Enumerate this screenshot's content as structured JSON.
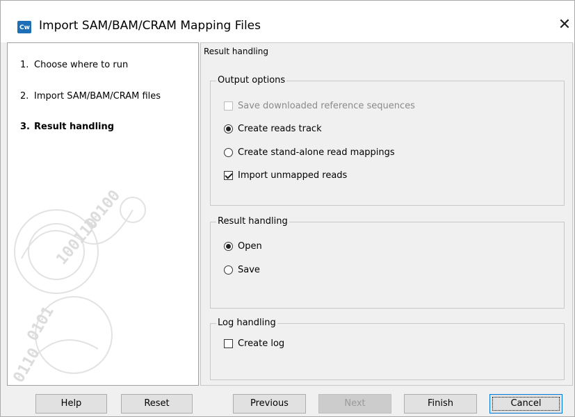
{
  "window": {
    "title": "Import SAM/BAM/CRAM Mapping Files",
    "app_icon_text": "Cw"
  },
  "steps": [
    {
      "number": "1.",
      "label": "Choose where to run",
      "active": false
    },
    {
      "number": "2.",
      "label": "Import SAM/BAM/CRAM files",
      "active": false
    },
    {
      "number": "3.",
      "label": "Result handling",
      "active": true
    }
  ],
  "main": {
    "heading": "Result handling",
    "output_options": {
      "legend": "Output options",
      "save_downloaded": {
        "label": "Save downloaded reference sequences",
        "checked": false,
        "enabled": false
      },
      "create_reads_track": {
        "label": "Create reads track",
        "selected": true
      },
      "create_standalone": {
        "label": "Create stand-alone read mappings",
        "selected": false
      },
      "import_unmapped": {
        "label": "Import unmapped reads",
        "checked": true
      }
    },
    "result_handling": {
      "legend": "Result handling",
      "open": {
        "label": "Open",
        "selected": true
      },
      "save": {
        "label": "Save",
        "selected": false
      }
    },
    "log_handling": {
      "legend": "Log handling",
      "create_log": {
        "label": "Create log",
        "checked": false
      }
    }
  },
  "buttons": {
    "help": "Help",
    "reset": "Reset",
    "previous": "Previous",
    "next": "Next",
    "finish": "Finish",
    "cancel": "Cancel"
  },
  "colors": {
    "accent": "#0078d7",
    "app_icon": "#1e6fb5",
    "watermark": "#e2e2e2"
  }
}
